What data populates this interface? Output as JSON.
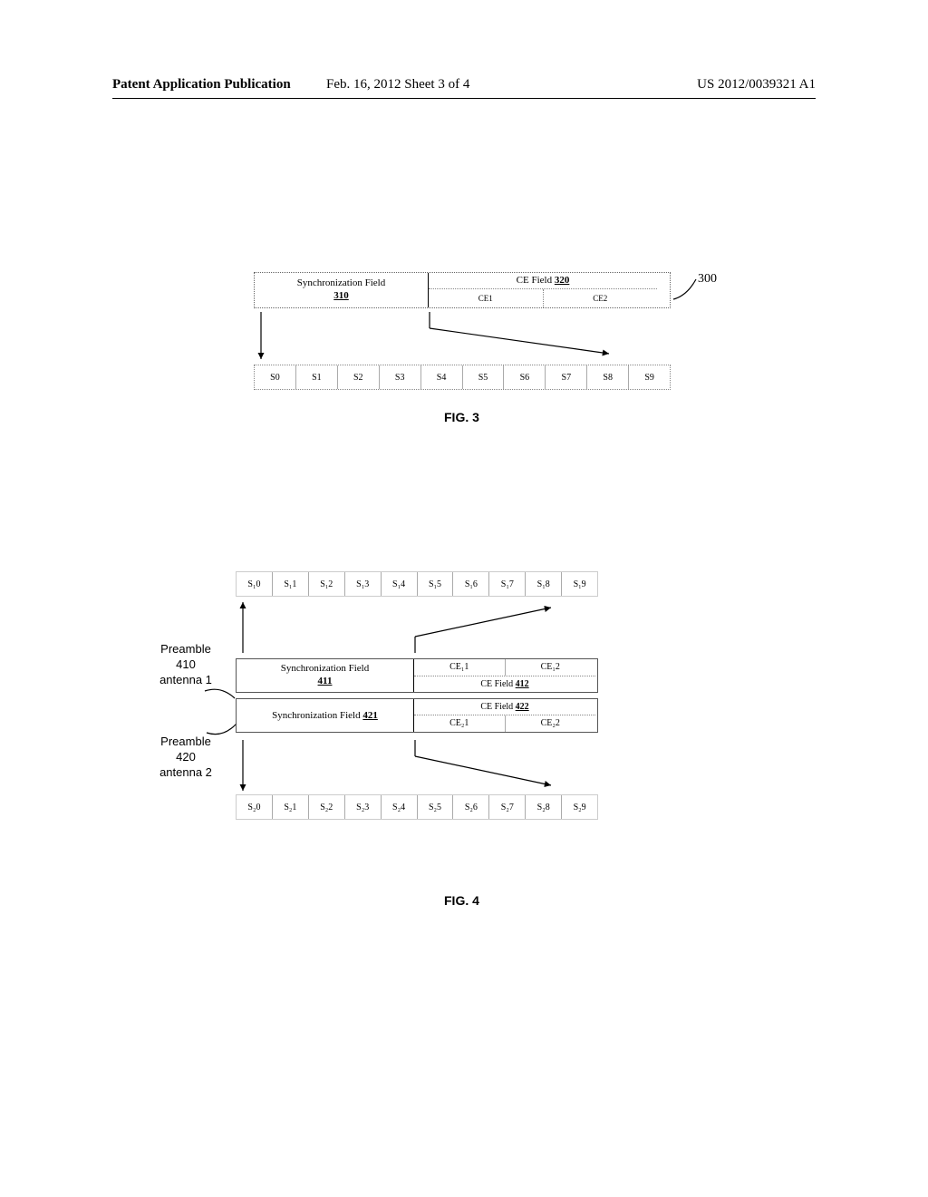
{
  "header": {
    "left": "Patent Application Publication",
    "center": "Feb. 16, 2012  Sheet 3 of 4",
    "right": "US 2012/0039321 A1"
  },
  "fig3": {
    "callout": "300",
    "sync_label": "Synchronization Field",
    "sync_ref": "310",
    "ce_label": "CE Field",
    "ce_ref": "320",
    "ce_subs": [
      "CE1",
      "CE2"
    ],
    "slots": [
      "S0",
      "S1",
      "S2",
      "S3",
      "S4",
      "S5",
      "S6",
      "S7",
      "S8",
      "S9"
    ],
    "label": "FIG. 3"
  },
  "fig4": {
    "preamble1": {
      "l1": "Preamble",
      "l2": "410",
      "l3": "antenna 1"
    },
    "preamble2": {
      "l1": "Preamble",
      "l2": "420",
      "l3": "antenna 2"
    },
    "slots1": [
      "S₁0",
      "S₁1",
      "S₁2",
      "S₁3",
      "S₁4",
      "S₁5",
      "S₁6",
      "S₁7",
      "S₁8",
      "S₁9"
    ],
    "slots2": [
      "S₂0",
      "S₂1",
      "S₂2",
      "S₂3",
      "S₂4",
      "S₂5",
      "S₂6",
      "S₂7",
      "S₂8",
      "S₂9"
    ],
    "sync1_label": "Synchronization Field",
    "sync1_ref": "411",
    "ce1_label": "CE Field",
    "ce1_ref": "412",
    "ce1_subs": [
      "CE₁1",
      "CE₁2"
    ],
    "sync2_label": "Synchronization Field",
    "sync2_ref": "421",
    "ce2_label": "CE Field",
    "ce2_ref": "422",
    "ce2_subs": [
      "CE₂1",
      "CE₂2"
    ],
    "label": "FIG. 4"
  }
}
